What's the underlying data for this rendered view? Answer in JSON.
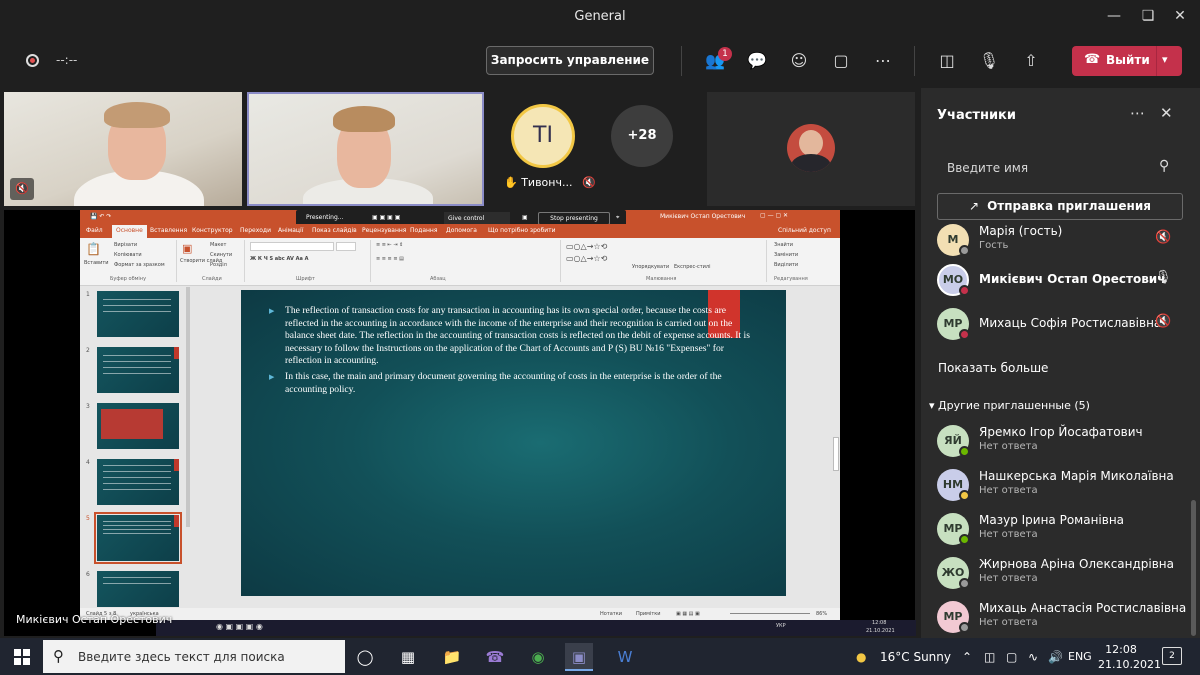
{
  "window": {
    "title": "General"
  },
  "toolbar": {
    "timer": "--:--",
    "request_control": "Запросить управление",
    "participants_badge": "1",
    "leave_label": "Выйти"
  },
  "stage": {
    "tiles": [
      {
        "name": "Тивонч...",
        "initials": "TI"
      },
      {
        "overflow": "+28"
      }
    ],
    "share_caption": "Микієвич Остап Орестович"
  },
  "presentation": {
    "title": "Микієвич Остап Орестович",
    "presenting_label": "Presenting...",
    "give_control": "Give control",
    "stop_presenting": "Stop presenting",
    "tabs": [
      "Файл",
      "Основне",
      "Вставлення",
      "Конструктор",
      "Переходи",
      "Анімації",
      "Показ слайдів",
      "Рецензування",
      "Подання",
      "Допомога"
    ],
    "tab_extra": "Що потрібно зробити",
    "share_label": "Спільний доступ",
    "ribbon_groups": [
      "Буфер обміну",
      "Слайди",
      "Шрифт",
      "Абзац",
      "Малювання",
      "Редагування"
    ],
    "ribbon_items": [
      "Вставити",
      "Вирізати",
      "Копіювати",
      "Формат за зразком",
      "Створити слайд",
      "Макет",
      "Скинути",
      "Розділ",
      "Упорядкувати",
      "Експрес-стилі",
      "Знайти",
      "Замінити",
      "Виділити"
    ],
    "slide_numbers": [
      "1",
      "2",
      "3",
      "4",
      "5",
      "6"
    ],
    "selected_slide": 5,
    "slide_paragraphs": [
      "The reflection of transaction costs for any transaction in accounting has its own special order, because the costs are reflected in the accounting in accordance with the income of the enterprise and their recognition is carried out on the balance sheet date. The reflection in the accounting of transaction costs is reflected on the debit of expense accounts. It is necessary to follow the Instructions on the application of the Chart of Accounts and P (S) BU №16 \"Expenses\" for reflection in accounting.",
      "In this case, the main and primary document governing the accounting of costs in the enterprise is the order of the accounting policy."
    ],
    "status_left": "Слайд 5 з 8",
    "status_lang": "українська",
    "status_notes": "Нотатки",
    "status_comments": "Примітки",
    "zoom": "86%",
    "inner_clock_time": "12:08",
    "inner_clock_date": "21.10.2021",
    "inner_lang": "УКР"
  },
  "panel": {
    "title": "Участники",
    "search_placeholder": "Введите имя",
    "invite_label": "Отправка приглашения",
    "participants": [
      {
        "initials": "М",
        "name": "Марія (гость)",
        "role": "Гость",
        "avatar_color": "#f2dfb3",
        "status_color": "#9a9a9a",
        "mic": "mic-off-icon"
      },
      {
        "initials": "МО",
        "name": "Микієвич Остап Орестович",
        "role": "",
        "avatar_color": "#c9cde9",
        "status_color": "#c4314b",
        "mic": "mic-icon"
      },
      {
        "initials": "МР",
        "name": "Михаць Софія Ростиславівна",
        "role": "",
        "avatar_color": "#c7e0c0",
        "status_color": "#c4314b",
        "mic": "mic-off-icon"
      }
    ],
    "show_more": "Показать больше",
    "others_header": "Другие приглашенные (5)",
    "others": [
      {
        "initials": "ЯЙ",
        "name": "Яремко Ігор Йосафатович",
        "status": "Нет ответа",
        "avatar_color": "#c7e0c0",
        "status_color": "#6bb700"
      },
      {
        "initials": "НМ",
        "name": "Нашкерська Марія Миколаївна",
        "status": "Нет ответа",
        "avatar_color": "#c9cde9",
        "status_color": "#f2c744"
      },
      {
        "initials": "МР",
        "name": "Мазур Ірина Романівна",
        "status": "Нет ответа",
        "avatar_color": "#c7e0c0",
        "status_color": "#6bb700"
      },
      {
        "initials": "ЖО",
        "name": "Жирнова Аріна Олександрівна",
        "status": "Нет ответа",
        "avatar_color": "#c7e0c0",
        "status_color": "#9a9a9a"
      },
      {
        "initials": "МР",
        "name": "Михаць Анастасія Ростиславівна",
        "status": "Нет ответа",
        "avatar_color": "#f2c9d3",
        "status_color": "#9a9a9a"
      }
    ]
  },
  "taskbar": {
    "search_placeholder": "Введите здесь текст для поиска",
    "weather": "16°C  Sunny",
    "lang": "ENG",
    "time": "12:08",
    "date": "21.10.2021",
    "notifications": "2"
  },
  "colors": {
    "leave": "#c4314b",
    "ppt_accent": "#c8512c",
    "active_speaker_border": "#8b8cc7"
  }
}
